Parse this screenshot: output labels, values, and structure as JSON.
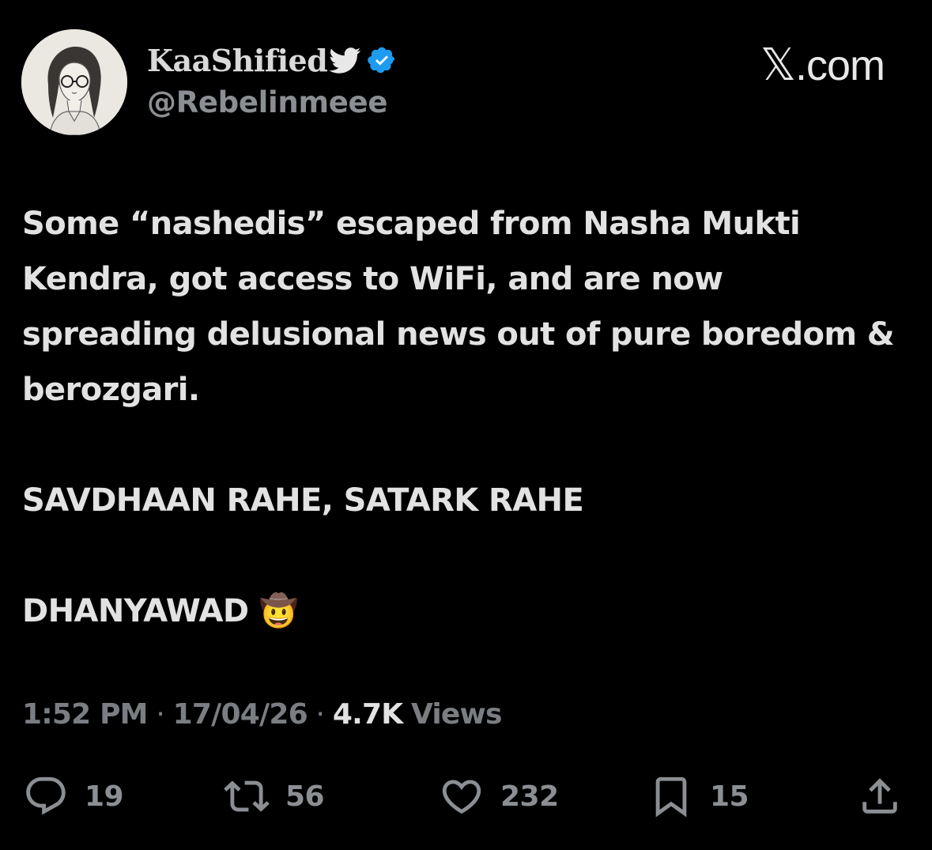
{
  "author": {
    "display_name": "KaaShified",
    "handle": "@Rebelinmeee",
    "avatar": "avatar-sketch-girl-with-glasses",
    "badges": [
      "twitter-bird-icon",
      "verified-badge-icon"
    ]
  },
  "brand": {
    "x_glyph": "𝕏",
    "suffix": ".com"
  },
  "tweet": {
    "paragraphs": [
      "Some “nashedis” escaped from Nasha Mukti Kendra, got access to WiFi, and are now spreading delusional news out of pure boredom & berozgari.",
      "SAVDHAAN RAHE, SATARK RAHE",
      "DHANYAWAD 🤠"
    ]
  },
  "meta": {
    "time": "1:52 PM",
    "separator": "·",
    "date": "17/04/26",
    "views_count": "4.7K",
    "views_label": "Views"
  },
  "actions": {
    "replies": "19",
    "reposts": "56",
    "likes": "232",
    "bookmarks": "15"
  },
  "colors": {
    "background": "#000000",
    "text": "#e2e2e2",
    "secondary_text": "#8b8f93",
    "verified_blue": "#1d9bf0"
  }
}
